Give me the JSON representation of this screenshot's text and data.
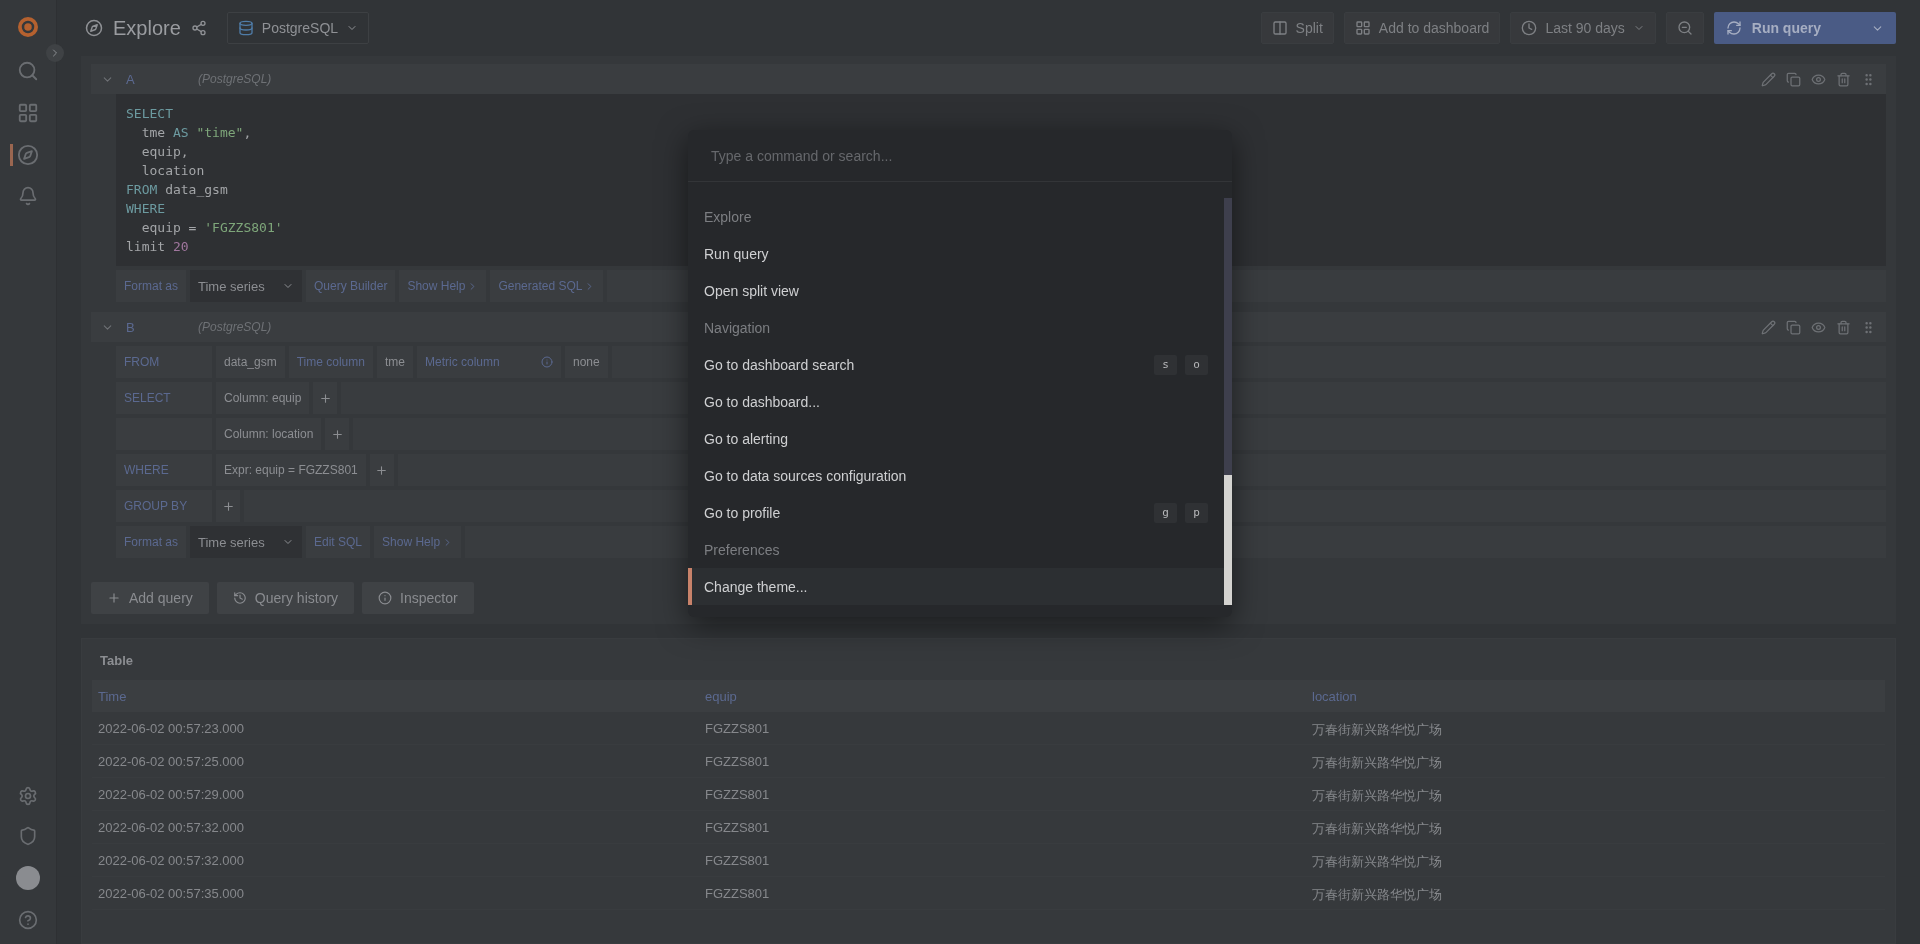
{
  "topbar": {
    "title": "Explore",
    "datasource": "PostgreSQL",
    "buttons": [
      {
        "kind": "split",
        "label": "Split"
      },
      {
        "kind": "dashboard",
        "label": "Add to dashboard"
      },
      {
        "kind": "time",
        "label": "Last 90 days"
      }
    ],
    "run": "Run query"
  },
  "queries": [
    {
      "letter": "A",
      "source": "(PostgreSQL)",
      "code": [
        [
          {
            "kind": "keyword",
            "text": "SELECT"
          }
        ],
        [
          {
            "kind": "plain",
            "text": "  tme "
          },
          {
            "kind": "keyword",
            "text": "AS "
          },
          {
            "kind": "string",
            "text": "\"time\""
          },
          {
            "kind": "plain",
            "text": ","
          }
        ],
        [
          {
            "kind": "plain",
            "text": "  equip,"
          }
        ],
        [
          {
            "kind": "plain",
            "text": "  location"
          }
        ],
        [
          {
            "kind": "keyword",
            "text": "FROM"
          },
          {
            "kind": "plain",
            "text": " data_gsm"
          }
        ],
        [
          {
            "kind": "keyword",
            "text": "WHERE"
          }
        ],
        [
          {
            "kind": "plain",
            "text": "  equip = "
          },
          {
            "kind": "string",
            "text": "'FGZZS801'"
          }
        ],
        [
          {
            "kind": "plain",
            "text": "limit "
          },
          {
            "kind": "number",
            "text": "20"
          }
        ]
      ],
      "footer": {
        "label": "Format as",
        "select": "Time series",
        "links": [
          {
            "text": "Query Builder",
            "chevron": false
          },
          {
            "text": "Show Help",
            "chevron": true
          },
          {
            "text": "Generated SQL",
            "chevron": true
          }
        ]
      }
    },
    {
      "letter": "B",
      "source": "(PostgreSQL)",
      "rows": [
        {
          "label": "FROM",
          "parts": [
            {
              "kind": "value",
              "text": "data_gsm"
            },
            {
              "kind": "label",
              "text": "Time column"
            },
            {
              "kind": "value",
              "text": "tme"
            },
            {
              "kind": "info",
              "text": "Metric column"
            },
            {
              "kind": "value",
              "text": "none"
            }
          ]
        },
        {
          "label": "SELECT",
          "parts": [
            {
              "kind": "value",
              "text": "Column: equip"
            },
            {
              "kind": "add"
            }
          ]
        },
        {
          "parts": [
            {
              "kind": "value",
              "text": "Column: location"
            },
            {
              "kind": "add"
            }
          ]
        },
        {
          "label": "WHERE",
          "parts": [
            {
              "kind": "value",
              "text": "Expr: equip = FGZZS801"
            },
            {
              "kind": "add"
            }
          ]
        },
        {
          "label": "GROUP BY",
          "parts": [
            {
              "kind": "add"
            }
          ]
        }
      ],
      "footer": {
        "label": "Format as",
        "select": "Time series",
        "links": [
          {
            "text": "Edit SQL",
            "chevron": false
          },
          {
            "text": "Show Help",
            "chevron": true
          }
        ]
      }
    }
  ],
  "actions": [
    {
      "kind": "add",
      "label": "Add query"
    },
    {
      "kind": "history",
      "label": "Query history"
    },
    {
      "kind": "info",
      "label": "Inspector"
    }
  ],
  "table": {
    "title": "Table",
    "columns": [
      "Time",
      "equip",
      "location"
    ],
    "rows": [
      [
        "2022-06-02 00:57:23.000",
        "FGZZS801",
        "万春街新兴路华悦广场"
      ],
      [
        "2022-06-02 00:57:25.000",
        "FGZZS801",
        "万春街新兴路华悦广场"
      ],
      [
        "2022-06-02 00:57:29.000",
        "FGZZS801",
        "万春街新兴路华悦广场"
      ],
      [
        "2022-06-02 00:57:32.000",
        "FGZZS801",
        "万春街新兴路华悦广场"
      ],
      [
        "2022-06-02 00:57:32.000",
        "FGZZS801",
        "万春街新兴路华悦广场"
      ],
      [
        "2022-06-02 00:57:35.000",
        "FGZZS801",
        "万春街新兴路华悦广场"
      ]
    ]
  },
  "palette": {
    "placeholder": "Type a command or search...",
    "items": [
      {
        "kind": "section",
        "label": "Explore"
      },
      {
        "kind": "action",
        "label": "Run query",
        "selected": false
      },
      {
        "kind": "action",
        "label": "Open split view",
        "selected": false
      },
      {
        "kind": "section",
        "label": "Navigation"
      },
      {
        "kind": "action",
        "label": "Go to dashboard search",
        "selected": false,
        "keys": [
          "s",
          "o"
        ]
      },
      {
        "kind": "action",
        "label": "Go to dashboard...",
        "selected": false
      },
      {
        "kind": "action",
        "label": "Go to alerting",
        "selected": false
      },
      {
        "kind": "action",
        "label": "Go to data sources configuration",
        "selected": false
      },
      {
        "kind": "action",
        "label": "Go to profile",
        "selected": false,
        "keys": [
          "g",
          "p"
        ]
      },
      {
        "kind": "section",
        "label": "Preferences"
      },
      {
        "kind": "action",
        "label": "Change theme...",
        "selected": true
      }
    ]
  }
}
